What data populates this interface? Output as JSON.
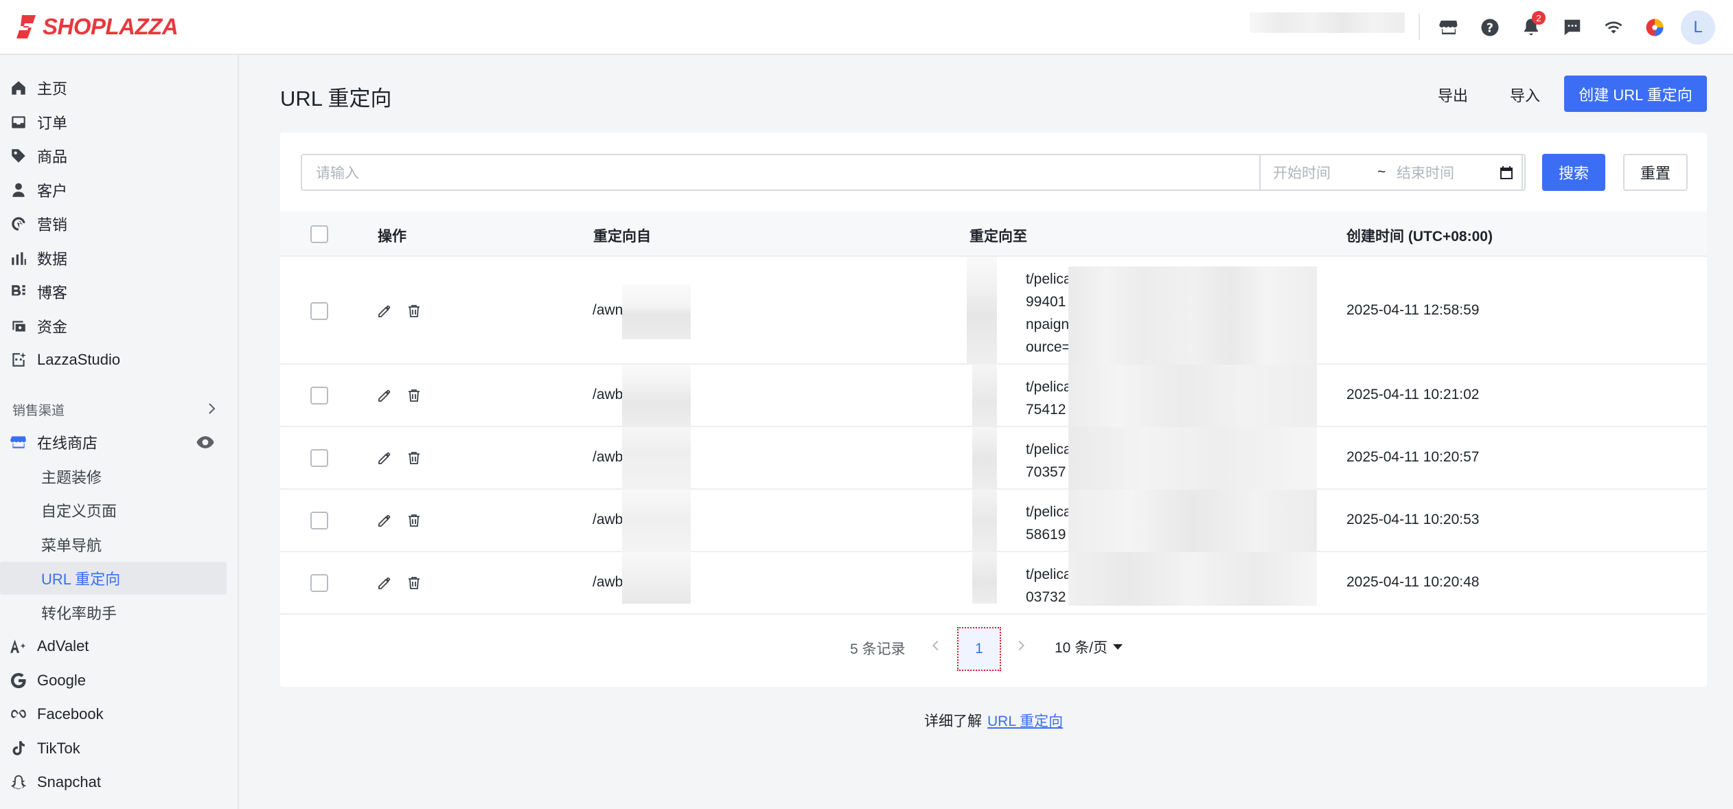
{
  "brand": {
    "name": "SHOPLAZZA",
    "color": "#e8383d"
  },
  "topbar": {
    "icons": [
      "store-icon",
      "help-icon",
      "bell-icon",
      "message-icon",
      "wifi-icon",
      "color-wheel-icon"
    ],
    "notification_count": "2",
    "avatar_letter": "L"
  },
  "sidebar": {
    "items": [
      {
        "label": "主页",
        "icon": "home-icon"
      },
      {
        "label": "订单",
        "icon": "inbox-icon"
      },
      {
        "label": "商品",
        "icon": "tag-icon"
      },
      {
        "label": "客户",
        "icon": "person-icon"
      },
      {
        "label": "营销",
        "icon": "marketing-icon"
      },
      {
        "label": "数据",
        "icon": "bar-chart-icon"
      },
      {
        "label": "博客",
        "icon": "blog-icon"
      },
      {
        "label": "资金",
        "icon": "wallet-icon"
      },
      {
        "label": "LazzaStudio",
        "icon": "studio-icon"
      }
    ],
    "channels_title": "销售渠道",
    "store_label": "在线商店",
    "store_sub": [
      "主题装修",
      "自定义页面",
      "菜单导航",
      "URL 重定向",
      "转化率助手"
    ],
    "apps": [
      {
        "label": "AdValet",
        "icon": "advalet-icon"
      },
      {
        "label": "Google",
        "icon": "google-icon"
      },
      {
        "label": "Facebook",
        "icon": "meta-icon"
      },
      {
        "label": "TikTok",
        "icon": "tiktok-icon"
      },
      {
        "label": "Snapchat",
        "icon": "snapchat-icon"
      }
    ]
  },
  "page": {
    "title": "URL 重定向",
    "export_label": "导出",
    "import_label": "导入",
    "create_label": "创建 URL 重定向"
  },
  "filters": {
    "search_placeholder": "请输入",
    "start_placeholder": "开始时间",
    "separator": "~",
    "end_placeholder": "结束时间",
    "search_label": "搜索",
    "reset_label": "重置"
  },
  "table": {
    "headers": [
      "操作",
      "重定向自",
      "重定向至",
      "创建时间 (UTC+08:00)"
    ],
    "rows": [
      {
        "from": "/awn",
        "to": [
          "t/pelica",
          "99401",
          "npaign",
          "ource="
        ],
        "created": "2025-04-11 12:58:59"
      },
      {
        "from": "/awb",
        "to": [
          "t/pelica",
          "75412"
        ],
        "created": "2025-04-11 10:21:02"
      },
      {
        "from": "/awb",
        "to": [
          "t/pelica",
          "70357"
        ],
        "created": "2025-04-11 10:20:57"
      },
      {
        "from": "/awb",
        "to": [
          "t/pelica",
          "58619"
        ],
        "created": "2025-04-11 10:20:53"
      },
      {
        "from": "/awb",
        "to": [
          "t/pelica",
          "03732"
        ],
        "created": "2025-04-11 10:20:48"
      }
    ]
  },
  "pagination": {
    "total": "5 条记录",
    "current_page": "1",
    "page_size": "10 条/页"
  },
  "footer": {
    "text": "详细了解",
    "link": "URL 重定向"
  }
}
